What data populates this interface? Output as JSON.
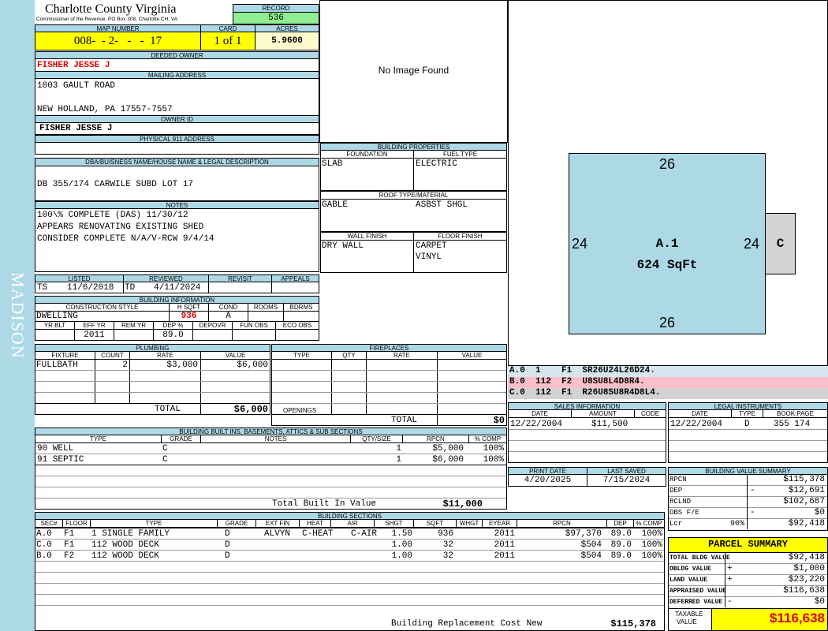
{
  "side_label": "MADISON",
  "header": {
    "county": "Charlotte County Virginia",
    "subtitle": "Commissioner of the Revenue, PO Box 308, Charlotte CH, VA",
    "record_label": "RECORD",
    "record": "536",
    "map_label": "MAP NUMBER",
    "map_number": "008-  - 2-   -   -  17",
    "card_label": "CARD",
    "card": "1 of 1",
    "acres_label": "ACRES",
    "acres": "5.9600"
  },
  "owner": {
    "deeded_label": "DEEDED OWNER",
    "deeded_owner": "FISHER JESSE J",
    "mailing_label": "MAILING ADDRESS",
    "address1": "1003 GAULT ROAD",
    "address2": "NEW HOLLAND, PA 17557-7557",
    "owner_id_label": "OWNER ID",
    "owner_id": "FISHER JESSE J",
    "physical_label": "PHYSICAL 911 ADDRESS"
  },
  "legal": {
    "label": "DBA/BUISNESS NAME/HOUSE NAME & LEGAL DESCRIPTION",
    "text": "DB 355/174 CARWILE SUBD LOT 17"
  },
  "notes": {
    "label": "NOTES",
    "lines": [
      "100\\% COMPLETE (DAS) 11/30/12",
      "APPEARS RENOVATING EXISTING SHED",
      "CONSIDER COMPLETE N/A/V-RCW 9/4/14"
    ]
  },
  "status": {
    "listed_label": "LISTED",
    "reviewed_label": "REVIEWED",
    "revisit_label": "REVISIT",
    "appeals_label": "APPEALS",
    "listed_by": "TS",
    "listed_date": "11/6/2018",
    "reviewed_by": "TD",
    "reviewed_date": "4/11/2024"
  },
  "building_info": {
    "label": "BUILDING INFORMATION",
    "cols": [
      "CONSTRUCTION STYLE",
      "H SQFT",
      "COND",
      "ROOMS",
      "BDRMS"
    ],
    "style": "DWELLING",
    "hsqft": "936",
    "cond": "A",
    "cols2": [
      "YR BLT",
      "EFF YR",
      "REM YR",
      "DEP %",
      "DEPOVR",
      "FUN OBS",
      "ECO OBS"
    ],
    "eff_yr": "2011",
    "dep": "89.0"
  },
  "plumbing": {
    "label": "PLUMBING",
    "cols": [
      "FIXTURE",
      "COUNT",
      "RATE",
      "VALUE"
    ],
    "rows": [
      {
        "fixture": "FULLBATH",
        "count": "2",
        "rate": "$3,000",
        "value": "$6,000"
      }
    ],
    "total_label": "TOTAL",
    "total": "$6,000"
  },
  "fireplaces": {
    "label": "FIREPLACES",
    "cols": [
      "TYPE",
      "QTY",
      "RATE",
      "VALUE"
    ],
    "openings_label": "OPENINGS",
    "total_label": "TOTAL",
    "total": "$0"
  },
  "built_ins": {
    "label": "BUILDING BUILT INS, BASEMENTS, ATTICS & SUB SECTIONS",
    "cols": [
      "TYPE",
      "GRADE",
      "NOTES",
      "QTY/SIZE",
      "RPCN",
      "% COMP"
    ],
    "rows": [
      {
        "type": "90 WELL",
        "grade": "C",
        "qty": "1",
        "rpcn": "$5,000",
        "comp": "100%"
      },
      {
        "type": "91 SEPTIC",
        "grade": "C",
        "qty": "1",
        "rpcn": "$6,000",
        "comp": "100%"
      }
    ],
    "total_label": "Total Built In Value",
    "total": "$11,000"
  },
  "sections": {
    "label": "BUILDING SECTIONS",
    "cols": [
      "SEC#",
      "FLOOR",
      "TYPE",
      "GRADE",
      "EXT FIN",
      "HEAT",
      "AIR",
      "SHGT",
      "SQFT",
      "WHGT",
      "EYEAR",
      "RPCN",
      "DEP",
      "% COMP"
    ],
    "rows": [
      {
        "sec": "A.0",
        "floor": "F1",
        "type": "1 SINGLE FAMILY",
        "grade": "D",
        "ext": "ALVYN",
        "heat": "C-HEAT",
        "air": "C-AIR",
        "shgt": "1.50",
        "sqft": "936",
        "whgt": "",
        "eyear": "2011",
        "rpcn": "$97,370",
        "dep": "89.0",
        "comp": "100%"
      },
      {
        "sec": "C.0",
        "floor": "F1",
        "type": "112 WOOD DECK",
        "grade": "D",
        "ext": "",
        "heat": "",
        "air": "",
        "shgt": "1.00",
        "sqft": "32",
        "whgt": "",
        "eyear": "2011",
        "rpcn": "$504",
        "dep": "89.0",
        "comp": "100%"
      },
      {
        "sec": "B.0",
        "floor": "F2",
        "type": "112 WOOD DECK",
        "grade": "D",
        "ext": "",
        "heat": "",
        "air": "",
        "shgt": "1.00",
        "sqft": "32",
        "whgt": "",
        "eyear": "2011",
        "rpcn": "$504",
        "dep": "89.0",
        "comp": "100%"
      }
    ],
    "total_label": "Building Replacement Cost New",
    "total": "$115,378"
  },
  "image": {
    "text": "No Image Found"
  },
  "props": {
    "label": "BUILDING PROPERTIES",
    "foundation_label": "FOUNDATION",
    "foundation": "SLAB",
    "fuel_label": "FUEL TYPE",
    "fuel": "ELECTRIC",
    "roof_label": "ROOF TYPE/MATERIAL",
    "roof_type": "GABLE",
    "roof_material": "ASBST SHGL",
    "wall_label": "WALL FINISH",
    "wall": "DRY WALL",
    "floor_label": "FLOOR FINISH",
    "floor1": "CARPET",
    "floor2": "VINYL"
  },
  "sketch": {
    "top": "26",
    "bottom": "26",
    "left": "24",
    "right": "24",
    "id": "A.1",
    "area": "624 SqFt",
    "small": "C"
  },
  "sketch_codes": [
    {
      "text": "A.0  1    F1  SR26U24L26D24.",
      "bg": "#d6e6ee"
    },
    {
      "text": "B.0  112  F2  U8SU8L4D8R4.",
      "bg": "#ffc0cb"
    },
    {
      "text": "C.0  112  F1  R26U8SU8R4D8L4.",
      "bg": "#d3d3d3"
    }
  ],
  "sales": {
    "label": "SALES INFORMATION",
    "cols": [
      "DATE",
      "AMOUNT",
      "CODE"
    ],
    "date": "12/22/2004",
    "amount": "$11,500"
  },
  "legal_instr": {
    "label": "LEGAL INSTRUMENTS",
    "cols": [
      "DATE",
      "TYPE",
      "BOOK:PAGE"
    ],
    "date": "12/22/2004",
    "type": "D",
    "book": "355 174"
  },
  "print": {
    "print_label": "PRINT DATE",
    "saved_label": "LAST SAVED",
    "print_date": "4/20/2025",
    "saved_date": "7/15/2024"
  },
  "bvs": {
    "label": "BUILDING VALUE SUMMARY",
    "rows": [
      {
        "label": "RPCN",
        "sign": "",
        "value": "$115,378"
      },
      {
        "label": "DEP",
        "sign": "-",
        "value": "$12,691"
      },
      {
        "label": "RCLND",
        "sign": "",
        "value": "$102,687"
      },
      {
        "label": "OBS F/E",
        "sign": "-",
        "value": "$0"
      },
      {
        "label": "Lcr",
        "pct": "90%",
        "sign": "",
        "value": "$92,418"
      }
    ]
  },
  "parcel": {
    "label": "PARCEL SUMMARY",
    "rows": [
      {
        "label": "TOTAL BLDG VALUE",
        "sign": "",
        "value": "$92,418"
      },
      {
        "label": "OBLDG VALUE",
        "sign": "+",
        "value": "$1,000"
      },
      {
        "label": "LAND VALUE",
        "sign": "+",
        "value": "$23,220"
      },
      {
        "label": "APPRAISED VALUE",
        "sign": "",
        "value": "$116,638"
      },
      {
        "label": "DEFERRED VALUE",
        "sign": "-",
        "value": "$0"
      }
    ],
    "taxable_label1": "TAXABLE",
    "taxable_label2": "VALUE",
    "taxable": "$116,638"
  }
}
